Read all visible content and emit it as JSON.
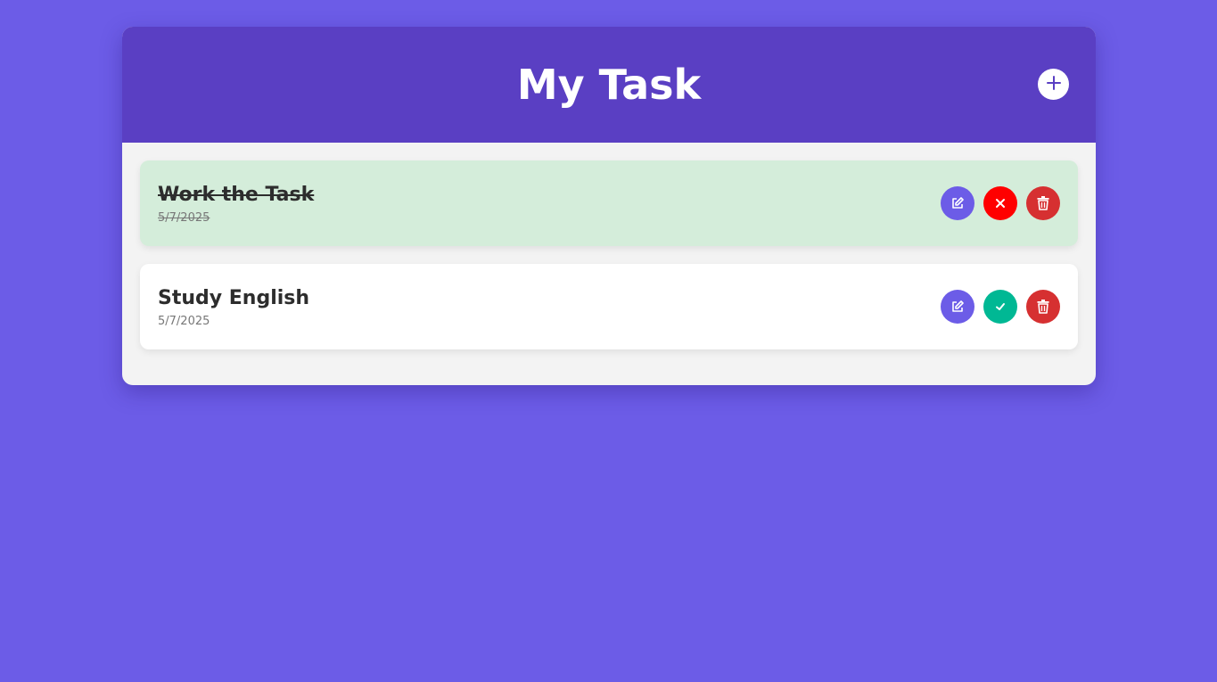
{
  "header": {
    "title": "My Task",
    "add_icon": "plus-icon"
  },
  "colors": {
    "background": "#6c5ce7",
    "header": "#5a3fc3",
    "completed_bg": "#d4edda",
    "edit": "#6c5ce7",
    "undo": "#ff0000",
    "complete": "#00b894",
    "delete": "#d63031"
  },
  "tasks": [
    {
      "title": "Work the Task",
      "date": "5/7/2025",
      "completed": true,
      "actions": [
        "edit-icon",
        "close-icon",
        "trash-icon"
      ]
    },
    {
      "title": "Study English",
      "date": "5/7/2025",
      "completed": false,
      "actions": [
        "edit-icon",
        "check-icon",
        "trash-icon"
      ]
    }
  ]
}
